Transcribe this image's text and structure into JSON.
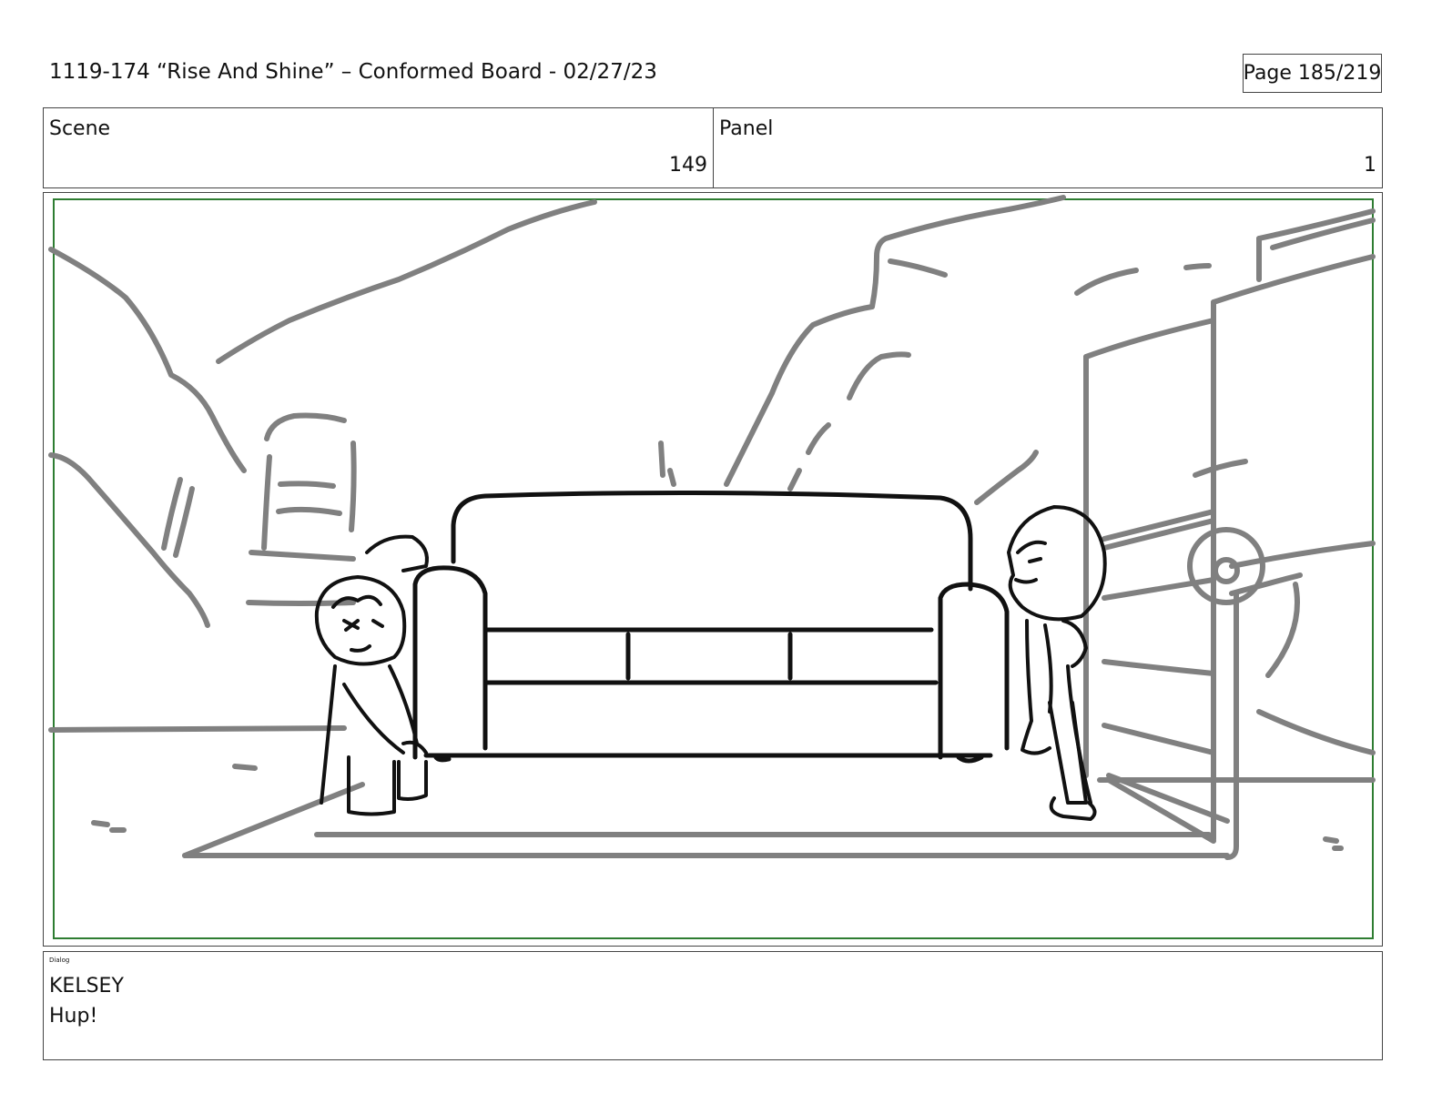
{
  "header": {
    "title": "1119-174 “Rise And Shine” – Conformed Board - 02/27/23",
    "page": "Page 185/219"
  },
  "info": {
    "scene_label": "Scene",
    "scene_value": "149",
    "panel_label": "Panel",
    "panel_value": "1"
  },
  "frame": {
    "safe_area_color": "#2e7d32",
    "ink_color": "#111111",
    "background_ink_color": "#808080"
  },
  "dialog": {
    "label": "Dialog",
    "speaker": "KELSEY",
    "line": "Hup!"
  }
}
